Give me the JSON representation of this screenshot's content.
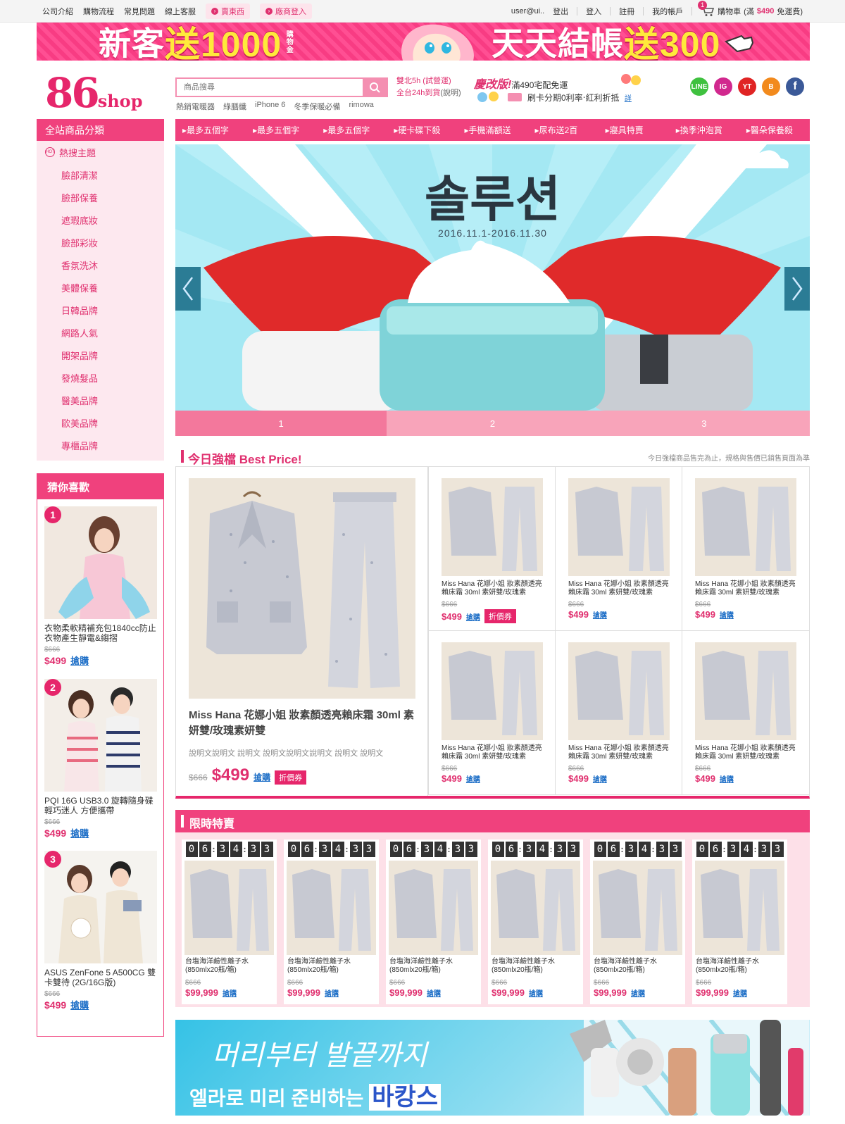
{
  "topbar": {
    "links": [
      "公司介紹",
      "購物流程",
      "常見問題",
      "線上客服"
    ],
    "pills": [
      "賣東西",
      "廠商登入"
    ],
    "user": "user@ui..",
    "logout": "登出",
    "login": "登入",
    "register": "註冊",
    "account": "我的帳戶",
    "cart_count": "1",
    "cart_label": "購物車",
    "cart_note_prefix": "(滿",
    "cart_note_amount": "$490",
    "cart_note_suffix": "免運費)"
  },
  "promo": {
    "left_prefix": "新客",
    "left_highlight": "送1000",
    "left_small": "購物金",
    "right_prefix": "天天結帳",
    "right_highlight": "送300"
  },
  "header": {
    "logo_number": "86",
    "logo_word": "shop",
    "search_placeholder": "商品搜尋",
    "hot_keywords": [
      "熱銷電暖器",
      "綠膳纖",
      "iPhone 6",
      "冬季保暖必備",
      "rimowa"
    ],
    "ship_line1": "雙北5h (試營運)",
    "ship_line2": "全台24h到貨",
    "ship_link": "(說明)",
    "ad_title": "慶改版!",
    "ad_sub": "滿490宅配免運",
    "ad_line2": "刷卡分期0利率‧紅利折抵",
    "ad_more": "詳",
    "social": [
      "LINE",
      "IG",
      "YT",
      "B",
      "f"
    ]
  },
  "catnav": [
    "▸最多五個字",
    "▸最多五個字",
    "▸最多五個字",
    "▸硬卡碟下殺",
    "▸手機滿額送",
    "▸尿布送2百",
    "▸寢具特賣",
    "▸換季沖泡賞",
    "▸醫朵保養殺"
  ],
  "sidebar": {
    "title": "全站商品分類",
    "hot_label": "熱搜主題",
    "hot_icon": "HOT",
    "items": [
      "臉部清潔",
      "臉部保養",
      "遮瑕底妝",
      "臉部彩妝",
      "香氛洗沐",
      "美體保養",
      "日韓品牌",
      "網路人氣",
      "開架品牌",
      "發燒髮品",
      "醫美品牌",
      "歐美品牌",
      "專櫃品牌"
    ]
  },
  "guess": {
    "title": "猜你喜歡",
    "items": [
      {
        "rank": "1",
        "name": "衣物柔軟精補充包1840cc防止衣物產生靜電&縐摺",
        "old": "$666",
        "price": "$499",
        "buy": "搶購"
      },
      {
        "rank": "2",
        "name": "PQI 16G USB3.0 旋轉隨身碟 輕巧迷人 方便攜帶",
        "old": "$666",
        "price": "$499",
        "buy": "搶購"
      },
      {
        "rank": "3",
        "name": "ASUS ZenFone 5 A500CG 雙卡雙待 (2G/16G版)",
        "old": "$666",
        "price": "$499",
        "buy": "搶購"
      }
    ]
  },
  "carousel": {
    "headline": "솔루션",
    "date": "2016.11.1-2016.11.30",
    "tabs": [
      "1",
      "2",
      "3"
    ],
    "active": 0
  },
  "best": {
    "title": "今日強檔 Best Price!",
    "note": "今日強檔商品售完為止，規格與售價已銷售頁面為準",
    "main": {
      "name": "Miss Hana 花娜小姐 妝素顏透亮賴床霜 30ml 素妍雙/玫瑰素妍雙",
      "desc": "說明文說明文 說明文 說明文說明文說明文 說明文 說明文",
      "old": "$666",
      "price": "$499",
      "buy": "搶購",
      "coupon": "折價券"
    },
    "items": [
      {
        "name": "Miss Hana 花娜小姐 妝素顏透亮賴床霜 30ml 素妍雙/玫瑰素",
        "old": "$666",
        "price": "$499",
        "buy": "搶購",
        "coupon": "折價券"
      },
      {
        "name": "Miss Hana 花娜小姐 妝素顏透亮賴床霜 30ml 素妍雙/玫瑰素",
        "old": "$666",
        "price": "$499",
        "buy": "搶購",
        "coupon": ""
      },
      {
        "name": "Miss Hana 花娜小姐 妝素顏透亮賴床霜 30ml 素妍雙/玫瑰素",
        "old": "$666",
        "price": "$499",
        "buy": "搶購",
        "coupon": ""
      },
      {
        "name": "Miss Hana 花娜小姐 妝素顏透亮賴床霜 30ml 素妍雙/玫瑰素",
        "old": "$666",
        "price": "$499",
        "buy": "搶購",
        "coupon": ""
      },
      {
        "name": "Miss Hana 花娜小姐 妝素顏透亮賴床霜 30ml 素妍雙/玫瑰素",
        "old": "$666",
        "price": "$499",
        "buy": "搶購",
        "coupon": ""
      },
      {
        "name": "Miss Hana 花娜小姐 妝素顏透亮賴床霜 30ml 素妍雙/玫瑰素",
        "old": "$666",
        "price": "$499",
        "buy": "搶購",
        "coupon": ""
      }
    ]
  },
  "flash": {
    "title": "限時特賣",
    "timer": [
      "0",
      "6",
      "3",
      "4",
      "3",
      "3"
    ],
    "items": [
      {
        "name": "台塩海洋鹼性離子水(850mlx20瓶/箱)",
        "old": "$666",
        "price": "$99,999",
        "buy": "搶購"
      },
      {
        "name": "台塩海洋鹼性離子水(850mlx20瓶/箱)",
        "old": "$666",
        "price": "$99,999",
        "buy": "搶購"
      },
      {
        "name": "台塩海洋鹼性離子水(850mlx20瓶/箱)",
        "old": "$666",
        "price": "$99,999",
        "buy": "搶購"
      },
      {
        "name": "台塩海洋鹼性離子水(850mlx20瓶/箱)",
        "old": "$666",
        "price": "$99,999",
        "buy": "搶購"
      },
      {
        "name": "台塩海洋鹼性離子水(850mlx20瓶/箱)",
        "old": "$666",
        "price": "$99,999",
        "buy": "搶購"
      },
      {
        "name": "台塩海洋鹼性離子水(850mlx20瓶/箱)",
        "old": "$666",
        "price": "$99,999",
        "buy": "搶購"
      }
    ]
  },
  "bottom_banner": {
    "line1": "머리부터 발끝까지",
    "line2": "엘라로 미리 준비하는",
    "highlight": "바캉스"
  },
  "colors": {
    "brand_pink": "#f0417d",
    "price_pink": "#e0306f",
    "link_blue": "#1e6fc7",
    "carousel_bg": "#a4e8f3"
  }
}
